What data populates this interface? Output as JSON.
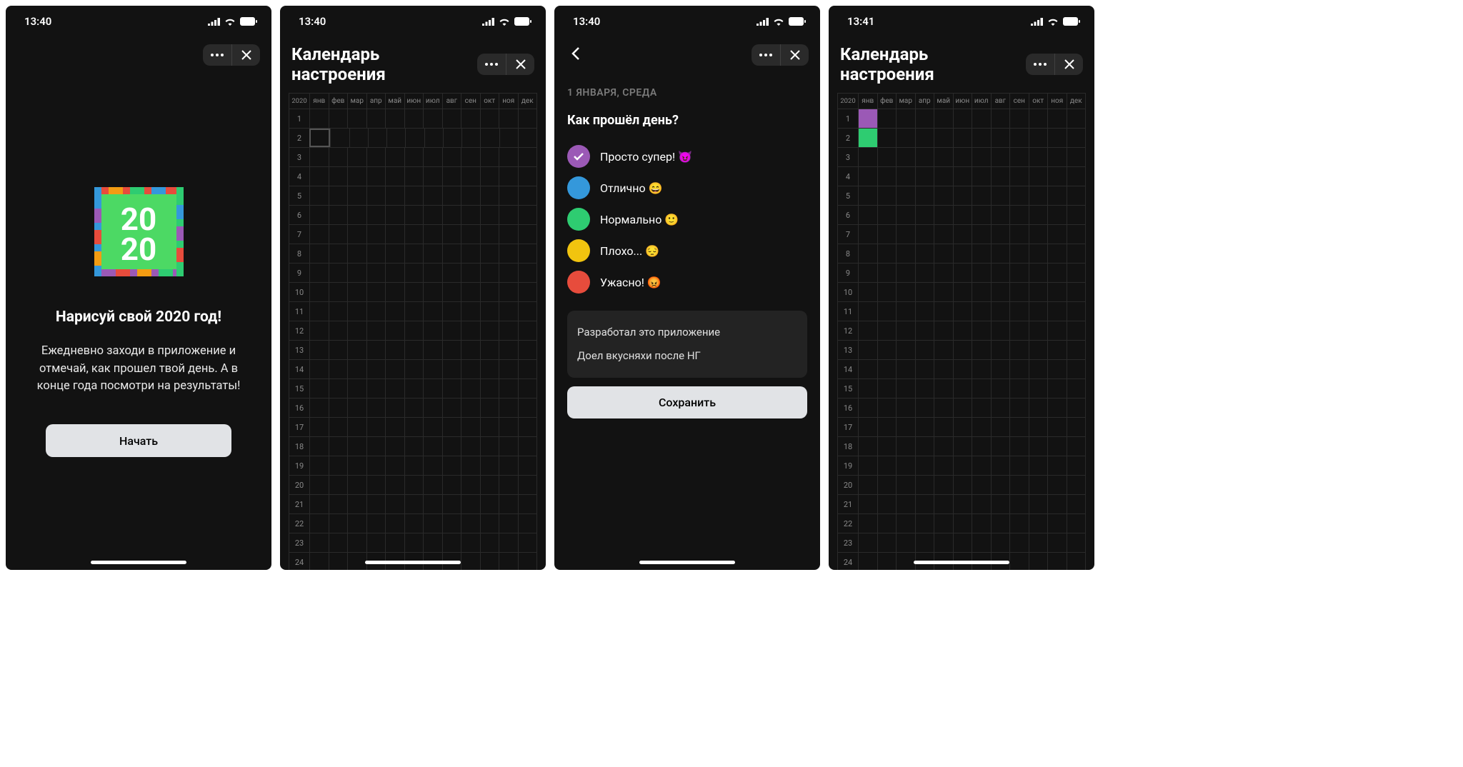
{
  "status": {
    "time1": "13:40",
    "time4": "13:41"
  },
  "screen1": {
    "title": "Нарисуй свой 2020 год!",
    "desc": "Ежедневно заходи в приложение и отмечай, как прошел твой день. А в конце года посмотри на результаты!",
    "start": "Начать",
    "logo_text": "2020"
  },
  "calendar": {
    "title": "Календарь настроения",
    "year": "2020",
    "months": [
      "янв",
      "фев",
      "мар",
      "апр",
      "май",
      "июн",
      "июл",
      "авг",
      "сен",
      "окт",
      "ноя",
      "дек"
    ],
    "days": [
      1,
      2,
      3,
      4,
      5,
      6,
      7,
      8,
      9,
      10,
      11,
      12,
      13,
      14,
      15,
      16,
      17,
      18,
      19,
      20,
      21,
      22,
      23,
      24
    ]
  },
  "mood": {
    "date": "1 ЯНВАРЯ, СРЕДА",
    "question": "Как прошёл день?",
    "options": [
      {
        "label": "Просто супер! 😈",
        "color": "#9b59b6",
        "selected": true
      },
      {
        "label": "Отлично 😄",
        "color": "#3498db",
        "selected": false
      },
      {
        "label": "Нормально 🙂",
        "color": "#2ecc71",
        "selected": false
      },
      {
        "label": "Плохо... 😔",
        "color": "#f1c40f",
        "selected": false
      },
      {
        "label": "Ужасно! 😡",
        "color": "#e74c3c",
        "selected": false
      }
    ],
    "note1": "Разработал это приложение",
    "note2": "Доел вкусняхи после НГ",
    "save": "Сохранить"
  }
}
